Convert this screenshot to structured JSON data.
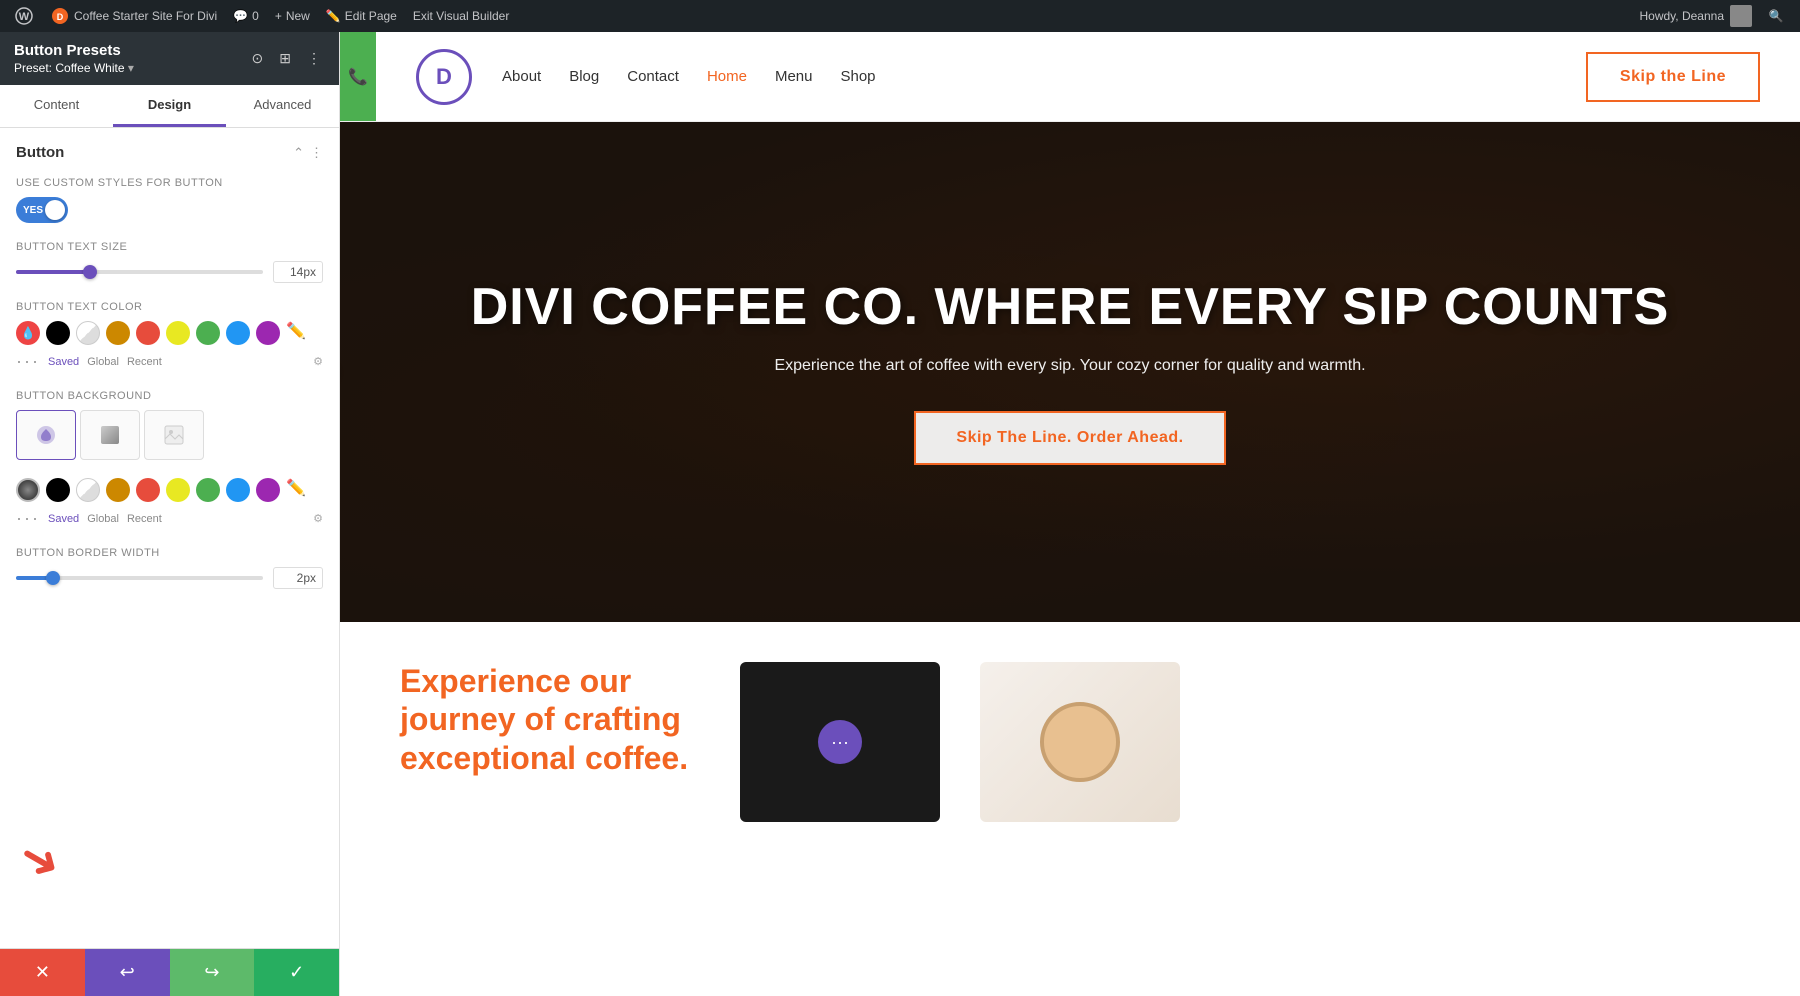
{
  "adminBar": {
    "wpLogo": "W",
    "siteName": "Coffee Starter Site For Divi",
    "comments": "0",
    "new": "New",
    "editPage": "Edit Page",
    "exitBuilder": "Exit Visual Builder",
    "howdy": "Howdy, Deanna"
  },
  "panel": {
    "title": "Button Presets",
    "preset": "Preset: Coffee White",
    "tabs": [
      "Content",
      "Design",
      "Advanced"
    ],
    "activeTab": "Design",
    "section": {
      "title": "Button",
      "fields": {
        "customStylesLabel": "Use Custom Styles For Button",
        "toggleValue": "YES",
        "textSizeLabel": "Button Text Size",
        "textSizeValue": "14px",
        "textColorLabel": "Button Text Color",
        "backgroundLabel": "Button Background",
        "borderWidthLabel": "Button Border Width",
        "borderWidthValue": "2px"
      }
    },
    "savedLabel": "Saved",
    "globalLabel": "Global",
    "recentLabel": "Recent",
    "footer": {
      "cancel": "✕",
      "undo": "↩",
      "redo": "↪",
      "confirm": "✓"
    }
  },
  "siteNav": {
    "logo": "D",
    "links": [
      "About",
      "Blog",
      "Contact",
      "Home",
      "Menu",
      "Shop"
    ],
    "activeLink": "Home",
    "skipBtn": "Skip the Line"
  },
  "hero": {
    "title": "DIVI COFFEE CO. WHERE EVERY SIP COUNTS",
    "subtitle": "Experience the art of coffee with every sip. Your cozy corner for quality and warmth.",
    "ctaBtn": "Skip The Line. Order Ahead."
  },
  "belowFold": {
    "title": "Experience our journey of crafting exceptional coffee."
  },
  "colors": {
    "eyedropper": "#e44",
    "swatches": [
      "#000000",
      "#ffffff",
      "#cc8800",
      "#e74c3c",
      "#e8e822",
      "#4caf50",
      "#2196f3",
      "#9c27b0"
    ],
    "bottomSwatches": [
      "#000000",
      "#ffffff",
      "#cc8800",
      "#e74c3c",
      "#e8e822",
      "#4caf50",
      "#2196f3",
      "#9c27b0"
    ]
  }
}
